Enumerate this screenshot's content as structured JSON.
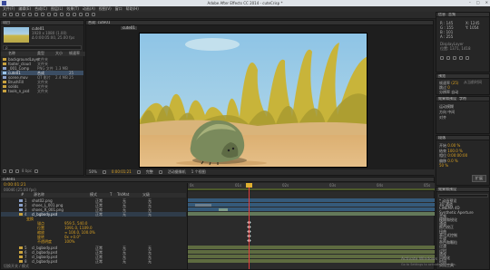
{
  "window": {
    "title": "Adobe After Effects CC 2014 - cuteCrisp *",
    "controls": [
      "–",
      "□",
      "✕"
    ]
  },
  "menu": [
    "文件(F)",
    "编辑(E)",
    "合成(C)",
    "图层(L)",
    "效果(T)",
    "动画(A)",
    "视图(V)",
    "窗口",
    "帮助(H)"
  ],
  "project": {
    "tab": "项目",
    "thumb_name": "cute01",
    "thumb_info": [
      "1920 x 1080 (1.00)",
      "Δ 0:00:05:00, 25.00 fps"
    ],
    "search_placeholder": "ρ",
    "columns": [
      "名称",
      "类型",
      "大小",
      "帧速率"
    ],
    "items": [
      {
        "name": "backgroundLayer",
        "type": "文件夹",
        "size": "",
        "rate": ""
      },
      {
        "name": "footer_cloud",
        "type": "文件夹",
        "size": "",
        "rate": ""
      },
      {
        "name": "_001_Comp",
        "type": "PNG 文件",
        "size": "1.3 MB",
        "rate": ""
      },
      {
        "name": "cute01",
        "type": "合成",
        "size": "",
        "rate": "25"
      },
      {
        "name": "scene.mov",
        "type": "QT 影片",
        "size": "2.4 MB",
        "rate": "25"
      },
      {
        "name": "BrushFill",
        "type": "文件夹",
        "size": "",
        "rate": ""
      },
      {
        "name": "solids",
        "type": "文件夹",
        "size": "",
        "rate": ""
      },
      {
        "name": "tools_n_psd",
        "type": "文件夹",
        "size": "",
        "rate": ""
      }
    ],
    "footer": "8 bpc"
  },
  "composition": {
    "tab": "合成: cute01",
    "subtab": "cute01",
    "zoom": "50%",
    "timecode": "0:00:01:21",
    "quality": "完整",
    "view": "活动摄像机",
    "views": "1 个视图"
  },
  "info": {
    "tabs": [
      "信息",
      "音频"
    ],
    "readout": [
      "R : 145",
      "G : 155",
      "B : 101",
      "A : 255"
    ],
    "coords": [
      "X: 1245",
      "Y: 1054"
    ],
    "label": "DisplayLayer",
    "label2": "位置: 1371, 1418"
  },
  "preview": {
    "tab": "预览",
    "rows": [
      "帧速率",
      "跳过",
      "分辨率"
    ],
    "values": [
      "(25)",
      "0",
      "自动"
    ],
    "checkbox": "从当前时间"
  },
  "effects_controls": {
    "tabs": [
      "效果和预设",
      "字符"
    ],
    "rows": [
      "运动模糊",
      "方向",
      "对齐"
    ],
    "values": [
      "  ",
      "中间",
      "  "
    ]
  },
  "character": {
    "tab": "段落",
    "rows": [
      "开始",
      "结束",
      "相位",
      "偏移"
    ],
    "values": [
      "0.00 %",
      "100.0 %",
      "0:00:00:00",
      "0.0 %"
    ],
    "amount": "50 %",
    "button": "扩展"
  },
  "effects_panel": {
    "tab": "效果和预设",
    "items": [
      "* 动画预设",
      "3D 通道",
      "CINEMA 4D",
      "Synthetic Aperture",
      "音频",
      "模糊和锐化",
      "通道",
      "颜色校正",
      "扭曲",
      "表达式控制",
      "生成",
      "杂色和颗粒",
      "过渡",
      "过时",
      "透视",
      "风格化",
      "时间",
      "实用工具"
    ]
  },
  "timeline": {
    "tab": "cute01",
    "timecode": "0:00:01:21",
    "frames": "00046 (25.00 fps)",
    "columns": [
      "#",
      "源名称",
      "模式",
      "T",
      "TrkMat",
      "父级"
    ],
    "layers": [
      {
        "num": "1",
        "name": "shot02.png",
        "mode": "正常",
        "trk": "无",
        "parent": "无"
      },
      {
        "num": "2",
        "name": "shoes_L_001.png",
        "mode": "正常",
        "trk": "无",
        "parent": "无"
      },
      {
        "num": "3",
        "name": "shoes_R_001.png",
        "mode": "正常",
        "trk": "无",
        "parent": "无"
      },
      {
        "num": "4",
        "name": "cl_bgbody.psd",
        "mode": "正常",
        "trk": "无",
        "parent": "无"
      }
    ],
    "transform_group": "变换",
    "properties": [
      {
        "name": "锚点",
        "value": "959.5, 540.0"
      },
      {
        "name": "位置",
        "value": "1091.0, 1109.0"
      },
      {
        "name": "缩放",
        "value": "∞ 100.0, 100.0%"
      },
      {
        "name": "旋转",
        "value": "0x +0.0°"
      },
      {
        "name": "不透明度",
        "value": "100%"
      }
    ],
    "more_layers": [
      {
        "num": "5",
        "name": "cl_bgbody.psd",
        "mode": "正常",
        "trk": "无",
        "parent": "无"
      },
      {
        "num": "6",
        "name": "cl_bgbody.psd",
        "mode": "正常",
        "trk": "无",
        "parent": "无"
      },
      {
        "num": "7",
        "name": "cl_bgbody.psd",
        "mode": "正常",
        "trk": "无",
        "parent": "无"
      },
      {
        "num": "8",
        "name": "cl_bgbody.psd",
        "mode": "正常",
        "trk": "无",
        "parent": "无"
      }
    ],
    "ruler_marks": [
      "0s",
      "01s",
      "02s",
      "03s",
      "04s",
      "05s"
    ],
    "footer": "切换开关 / 模式"
  },
  "watermark": {
    "line1": "Activate Windows",
    "line2": "Go to Settings to activate Windows."
  },
  "colors": {
    "playhead": "#e13c3c",
    "orange": "#d8a022",
    "panel": "#262626"
  }
}
